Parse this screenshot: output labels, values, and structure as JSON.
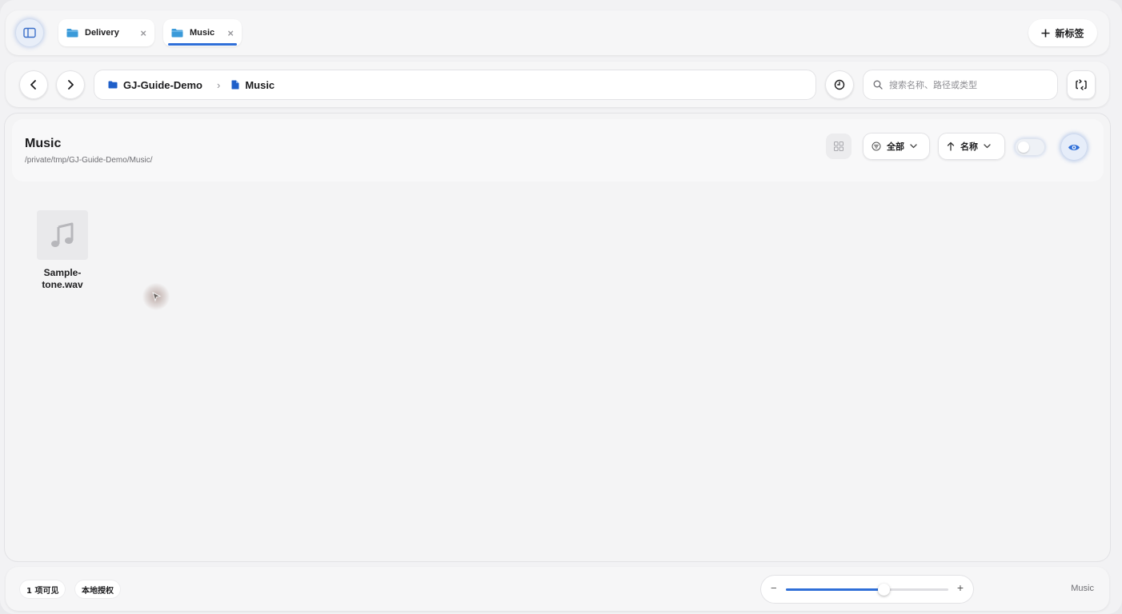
{
  "tabs": [
    {
      "label": "Delivery",
      "active": false
    },
    {
      "label": "Music",
      "active": true
    }
  ],
  "tabbar": {
    "new_tab_label": "新标签"
  },
  "nav": {
    "breadcrumb": [
      {
        "label": "GJ-Guide-Demo",
        "icon": "folder-icon"
      },
      {
        "label": "Music",
        "icon": "file-icon"
      }
    ],
    "search_placeholder": "搜索名称、路径或类型"
  },
  "main": {
    "title": "Music",
    "path": "/private/tmp/GJ-Guide-Demo/Music/",
    "filter_label": "全部",
    "sort_label": "名称",
    "preview_toggle_on": false
  },
  "files": [
    {
      "name_line1": "Sample-",
      "name_line2": "tone.wav",
      "icon": "music-note-icon"
    }
  ],
  "status": {
    "visible_count": "1 项可见",
    "auth": "本地授权",
    "zoom_level": 0.6,
    "location": "Music"
  },
  "colors": {
    "accent": "#2f6fd8",
    "folder": "#3a9ad9",
    "crumb_blue": "#1f5fc9"
  }
}
